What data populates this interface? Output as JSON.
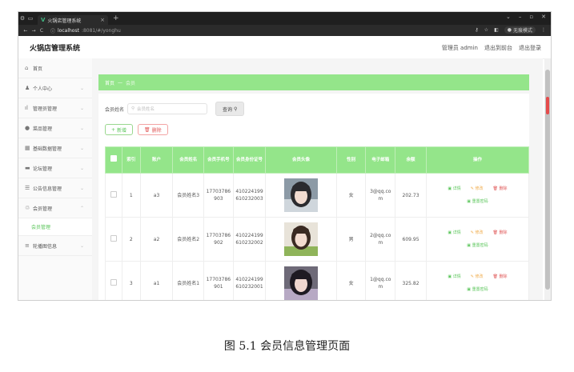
{
  "browser": {
    "tab_title": "火锅店管理系统",
    "url_host": "localhost",
    "url_path": ":8081/#/yonghu",
    "incognito_label": "无痕模式"
  },
  "app": {
    "title": "火锅店管理系统",
    "admin_label": "管理员 admin",
    "to_front": "退出到前台",
    "logout": "退出登录"
  },
  "sidebar": {
    "items": [
      {
        "label": "首页",
        "icon": "home-icon"
      },
      {
        "label": "个人中心",
        "icon": "user-icon"
      },
      {
        "label": "管理员管理",
        "icon": "chart-icon"
      },
      {
        "label": "菜品管理",
        "icon": "dish-icon"
      },
      {
        "label": "基础数据管理",
        "icon": "grid-icon"
      },
      {
        "label": "论坛管理",
        "icon": "forum-icon"
      },
      {
        "label": "公告信息管理",
        "icon": "notice-icon"
      },
      {
        "label": "会员管理",
        "icon": "member-icon"
      },
      {
        "label": "会员管理",
        "icon": ""
      },
      {
        "label": "轮播图信息",
        "icon": "list-icon"
      }
    ]
  },
  "breadcrumb": {
    "home": "首页",
    "current": "会员"
  },
  "search": {
    "label": "会员姓名",
    "placeholder": "会员姓名",
    "query_button": "查询"
  },
  "actions": {
    "add": "新增",
    "delete": "删除"
  },
  "table": {
    "headers": [
      "",
      "索引",
      "账户",
      "会员姓名",
      "会员手机号",
      "会员身份证号",
      "会员头像",
      "性别",
      "电子邮箱",
      "余额",
      "操作"
    ],
    "rows": [
      {
        "index": "1",
        "account": "a3",
        "name": "会员姓名3",
        "phone": "17703786903",
        "idcard": "410224199610232003",
        "gender": "女",
        "email": "3@qq.com",
        "balance": "202.73"
      },
      {
        "index": "2",
        "account": "a2",
        "name": "会员姓名2",
        "phone": "17703786902",
        "idcard": "410224199610232002",
        "gender": "男",
        "email": "2@qq.com",
        "balance": "609.95"
      },
      {
        "index": "3",
        "account": "a1",
        "name": "会员姓名1",
        "phone": "17703786901",
        "idcard": "410224199610232001",
        "gender": "女",
        "email": "1@qq.com",
        "balance": "325.82"
      }
    ],
    "ops": {
      "view": "详情",
      "edit": "修改",
      "delete": "删除",
      "reset": "重置密码"
    }
  },
  "caption": "图 5.1  会员信息管理页面",
  "colors": {
    "accent": "#94e58a",
    "brand_green": "#5bc65b",
    "danger": "#e05858",
    "warning": "#f0ad4e"
  }
}
